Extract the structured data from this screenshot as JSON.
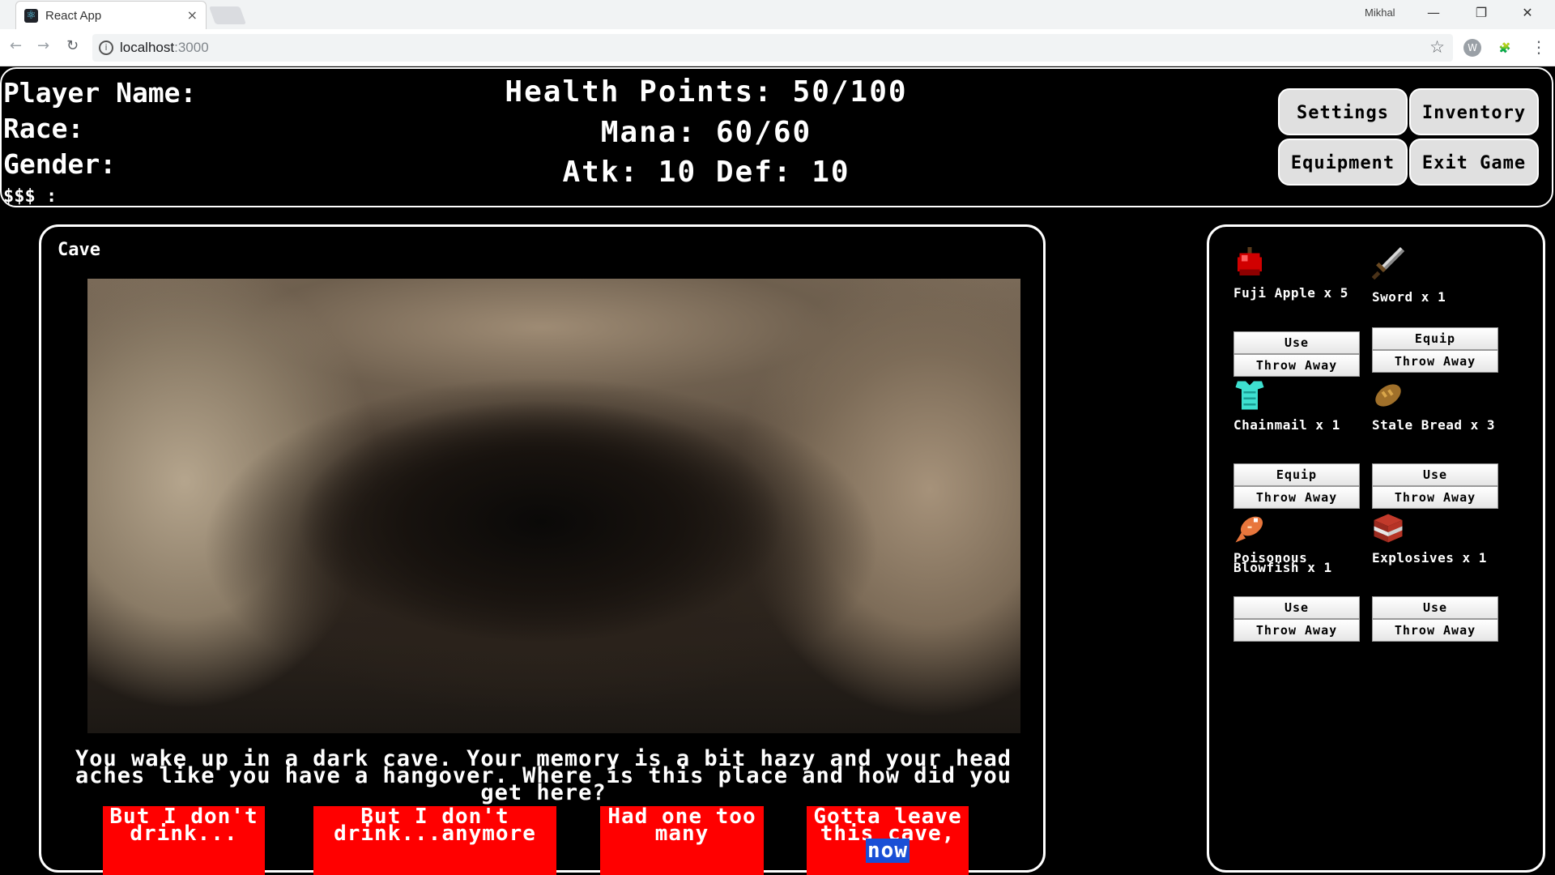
{
  "browser": {
    "tab_title": "React App",
    "tab_close": "×",
    "profile_name": "Mikhal",
    "window_controls": {
      "minimize": "—",
      "restore": "❐",
      "close": "✕"
    },
    "nav": {
      "back": "←",
      "forward": "→",
      "reload": "↻"
    },
    "address": {
      "host": "localhost",
      "port": ":3000"
    },
    "bookmark_icon": "☆",
    "extensions": [
      "W",
      "🧩"
    ],
    "menu": "⋮"
  },
  "player": {
    "name_label": "Player Name:",
    "race_label": "Race:",
    "gender_label": "Gender:",
    "money_label": "$$$ :"
  },
  "stats": {
    "health": "Health Points: 50/100",
    "mana": "Mana: 60/60",
    "atk_def": "Atk: 10 Def: 10"
  },
  "menu_buttons": {
    "settings": "Settings",
    "inventory": "Inventory",
    "equipment": "Equipment",
    "exit": "Exit Game"
  },
  "scene": {
    "title": "Cave",
    "narration": "You wake up in a dark cave. Your memory is a bit hazy and your head aches like you have a hangover. Where is this place and how did you get here?",
    "choices": [
      "But I don't drink...",
      "But I don't drink...anymore",
      "Had one too many",
      {
        "text": "Gotta leave this cave, ",
        "highlight": "now"
      }
    ]
  },
  "inventory": {
    "items": [
      {
        "icon": "apple-icon",
        "label": "Fuji Apple x 5",
        "primary": "Use",
        "secondary": "Throw Away"
      },
      {
        "icon": "sword-icon",
        "label": "Sword x 1",
        "primary": "Equip",
        "secondary": "Throw Away"
      },
      {
        "icon": "chainmail-icon",
        "label": "Chainmail x 1",
        "primary": "Equip",
        "secondary": "Throw Away"
      },
      {
        "icon": "bread-icon",
        "label": "Stale Bread x 3",
        "primary": "Use",
        "secondary": "Throw Away"
      },
      {
        "icon": "blowfish-icon",
        "label": "Poisonous Blowfish x 1",
        "primary": "Use",
        "secondary": "Throw Away"
      },
      {
        "icon": "tnt-icon",
        "label": "Explosives x 1",
        "primary": "Use",
        "secondary": "Throw Away"
      }
    ]
  },
  "colors": {
    "background": "#000000",
    "choice_button": "#ff0000",
    "highlight": "#1a4fd6"
  }
}
